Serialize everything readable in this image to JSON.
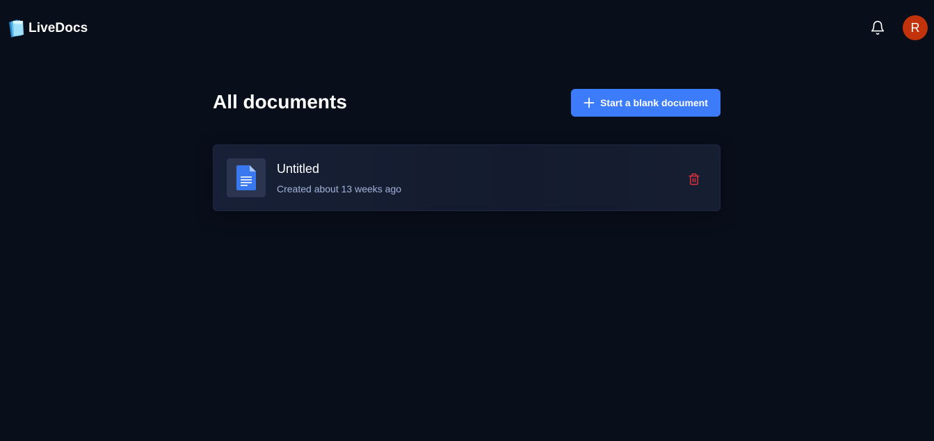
{
  "header": {
    "brand": "LiveDocs",
    "logo_icon": "livedocs-logo-icon",
    "notification_icon": "bell-icon",
    "avatar_initial": "R",
    "avatar_color": "#c2330b"
  },
  "main": {
    "title": "All documents",
    "new_document_button": {
      "label": "Start a blank document",
      "icon": "plus-icon",
      "color": "#3c7bfa"
    },
    "documents": [
      {
        "title": "Untitled",
        "meta": "Created about 13 weeks ago",
        "icon": "document-icon",
        "action_icon": "trash-icon",
        "action_color": "#e0313c"
      }
    ]
  }
}
